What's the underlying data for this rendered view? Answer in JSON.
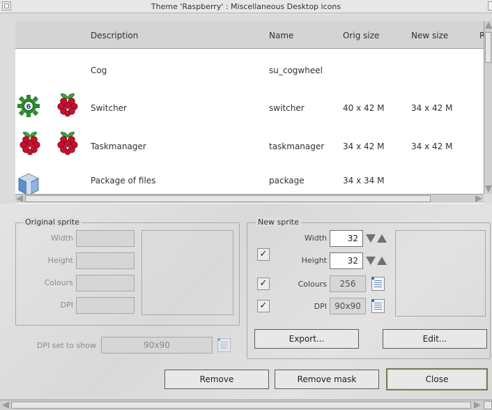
{
  "window": {
    "title": "Theme 'Raspberry' : Miscellaneous Desktop icons"
  },
  "list": {
    "columns": [
      "Description",
      "Name",
      "Orig size",
      "New size",
      "R"
    ],
    "rows": [
      {
        "description": "Cog",
        "name": "su_cogwheel",
        "orig_size": "",
        "new_size": "",
        "icons": []
      },
      {
        "description": "Switcher",
        "name": "switcher",
        "orig_size": "40 x 42 M",
        "new_size": "34 x 42 M",
        "icons": [
          "cogwheel-6-icon",
          "raspberry-icon"
        ]
      },
      {
        "description": "Taskmanager",
        "name": "taskmanager",
        "orig_size": "34 x 42 M",
        "new_size": "34 x 42 M",
        "icons": [
          "raspberry-icon",
          "raspberry-icon"
        ]
      },
      {
        "description": "Package of files",
        "name": "package",
        "orig_size": "34 x 34 M",
        "new_size": "",
        "icons": [
          "package-cube-icon"
        ]
      }
    ],
    "cog_badge": "6"
  },
  "original_sprite": {
    "label": "Original sprite",
    "width_label": "Width",
    "height_label": "Height",
    "colours_label": "Colours",
    "dpi_label": "DPI",
    "width_value": "",
    "height_value": "",
    "colours_value": "",
    "dpi_value": ""
  },
  "dpi_show": {
    "label": "DPI set to show",
    "value": "90x90"
  },
  "new_sprite": {
    "label": "New sprite",
    "width_label": "Width",
    "width_value": "32",
    "height_label": "Height",
    "height_value": "32",
    "colours_label": "Colours",
    "colours_value": "256",
    "dpi_label": "DPI",
    "dpi_value": "90x90",
    "size_checked": "✓",
    "colours_checked": "✓",
    "dpi_checked": "✓"
  },
  "buttons": {
    "export": "Export...",
    "edit": "Edit...",
    "remove": "Remove",
    "remove_mask": "Remove mask",
    "close": "Close"
  },
  "colors": {
    "raspberry_red": "#c8102e",
    "leaf_green": "#3aa53a",
    "cog_green": "#2c8a2c"
  }
}
